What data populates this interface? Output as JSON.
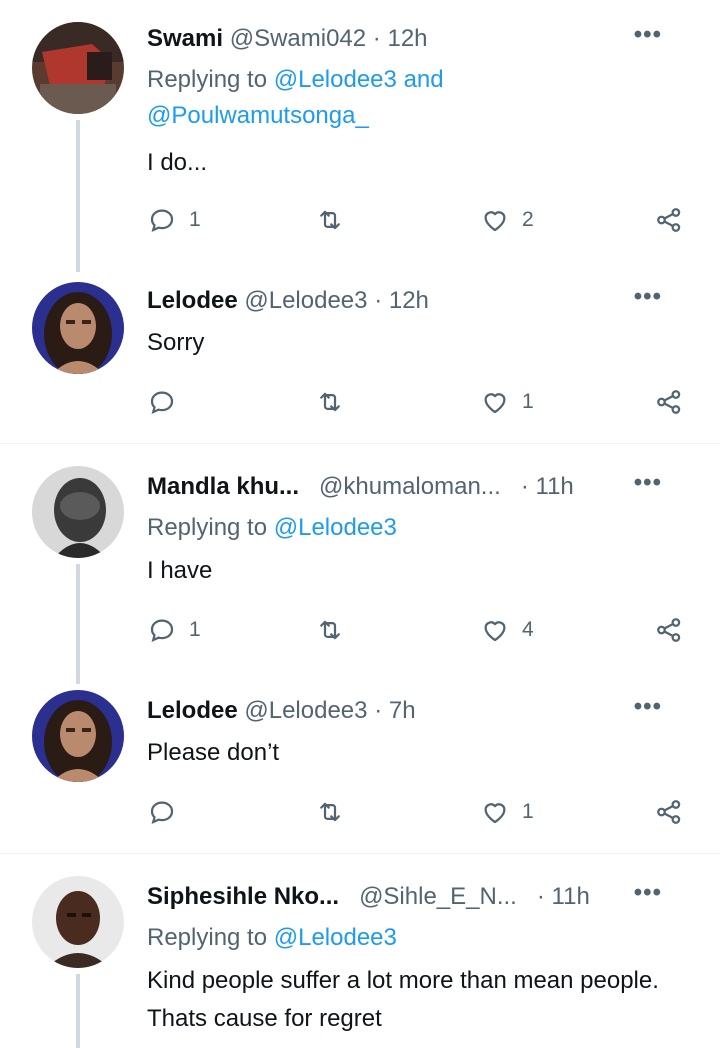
{
  "tweets": [
    {
      "name": "Swami",
      "handle": "@Swami042",
      "time": "12h",
      "replying_prefix": "Replying to",
      "replying_mentions": "@Lelodee3",
      "replying_and": "and",
      "replying_mentions2": "@Poulwamutsonga_",
      "text": "I do...",
      "reply_count": "1",
      "retweet_count": "",
      "like_count": "2"
    },
    {
      "name": "Lelodee",
      "handle": "@Lelodee3",
      "time": "12h",
      "text": "Sorry",
      "reply_count": "",
      "retweet_count": "",
      "like_count": "1"
    },
    {
      "name": "Mandla khu...",
      "handle": "@khumaloman...",
      "time": "11h",
      "replying_prefix": "Replying to",
      "replying_mentions": "@Lelodee3",
      "text": "I have",
      "reply_count": "1",
      "retweet_count": "",
      "like_count": "4"
    },
    {
      "name": "Lelodee",
      "handle": "@Lelodee3",
      "time": "7h",
      "text": "Please don’t",
      "reply_count": "",
      "retweet_count": "",
      "like_count": "1"
    },
    {
      "name": "Siphesihle Nko...",
      "handle": "@Sihle_E_N...",
      "time": "11h",
      "replying_prefix": "Replying to",
      "replying_mentions": "@Lelodee3",
      "text": "Kind people suffer a lot more than mean people. Thats cause for regret"
    }
  ],
  "separator": "·",
  "more_icon": "more-dots-icon",
  "colors": {
    "link": "#1d9bf0",
    "secondary": "#536471",
    "thread_line": "#cfd9de",
    "text": "#0f1419"
  }
}
